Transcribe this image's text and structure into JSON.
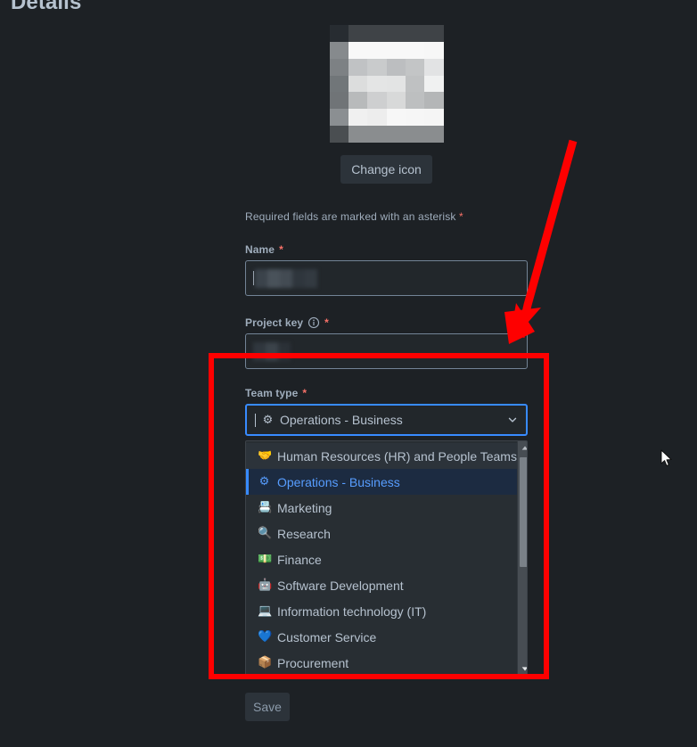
{
  "page": {
    "title": "Details",
    "background_color": "#1d2125"
  },
  "icon_section": {
    "avatar_name": "project-icon-redacted",
    "change_icon_label": "Change icon"
  },
  "form": {
    "required_note": "Required fields are marked with an asterisk",
    "required_marker": "*",
    "name_field": {
      "label": "Name",
      "required_marker": "*",
      "value": "",
      "redacted": true
    },
    "project_key_field": {
      "label": "Project key",
      "info_icon": "info-icon",
      "required_marker": "*",
      "value": "",
      "redacted": true
    },
    "team_type_field": {
      "label": "Team type",
      "required_marker": "*",
      "selected_value": "Operations - Business",
      "selected_icon": "gear-emoji",
      "chevron_icon": "chevron-down-icon",
      "expanded": true
    },
    "save_label": "Save"
  },
  "dropdown": {
    "options": [
      {
        "label": "Human Resources (HR) and People Teams",
        "icon": "🤝",
        "icon_name": "handshake-emoji",
        "state": "hovered"
      },
      {
        "label": "Operations - Business",
        "icon": "⚙",
        "icon_name": "gear-emoji",
        "state": "selected"
      },
      {
        "label": "Marketing",
        "icon": "📇",
        "icon_name": "card-index-emoji",
        "state": "normal"
      },
      {
        "label": "Research",
        "icon": "🔍",
        "icon_name": "magnifier-emoji",
        "state": "normal"
      },
      {
        "label": "Finance",
        "icon": "💵",
        "icon_name": "money-emoji",
        "state": "normal"
      },
      {
        "label": "Software Development",
        "icon": "🤖",
        "icon_name": "robot-emoji",
        "state": "normal"
      },
      {
        "label": "Information technology (IT)",
        "icon": "💻",
        "icon_name": "laptop-emoji",
        "state": "normal"
      },
      {
        "label": "Customer Service",
        "icon": "💙",
        "icon_name": "blue-heart-emoji",
        "state": "normal"
      },
      {
        "label": "Procurement",
        "icon": "📦",
        "icon_name": "package-emoji",
        "state": "normal"
      }
    ],
    "scrollbar": {
      "up_arrow": "▲",
      "down_arrow": "▼"
    }
  },
  "annotations": {
    "highlight_color": "#fe0000",
    "rectangle_target": "team-type-dropdown",
    "arrow_target": "team-type-dropdown"
  },
  "colors": {
    "accent_blue": "#388bff",
    "selected_text": "#579dff",
    "required_red": "#f87168",
    "panel": "#282e33",
    "input": "#22272b"
  }
}
